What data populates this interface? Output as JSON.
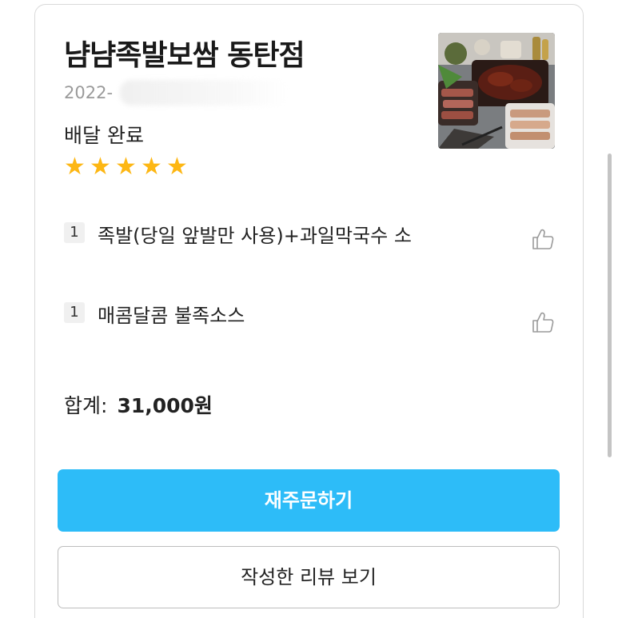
{
  "store": {
    "name": "냠냠족발보쌈 동탄점",
    "order_date": "2022-",
    "status": "배달 완료",
    "rating": 5,
    "stars": [
      "★",
      "★",
      "★",
      "★",
      "★"
    ]
  },
  "items": [
    {
      "qty": "1",
      "name": "족발(당일 앞발만 사용)+과일막국수 소"
    },
    {
      "qty": "1",
      "name": "매콤달콤 불족소스"
    }
  ],
  "total": {
    "label": "합계:",
    "value": "31,000원"
  },
  "buttons": {
    "reorder": "재주문하기",
    "view_review": "작성한 리뷰 보기"
  },
  "colors": {
    "accent": "#2dbcf8",
    "star": "#fdb714",
    "date_text": "#9a9a9a"
  },
  "icons": {
    "like": "thumbs-up-icon",
    "star": "star-icon"
  }
}
